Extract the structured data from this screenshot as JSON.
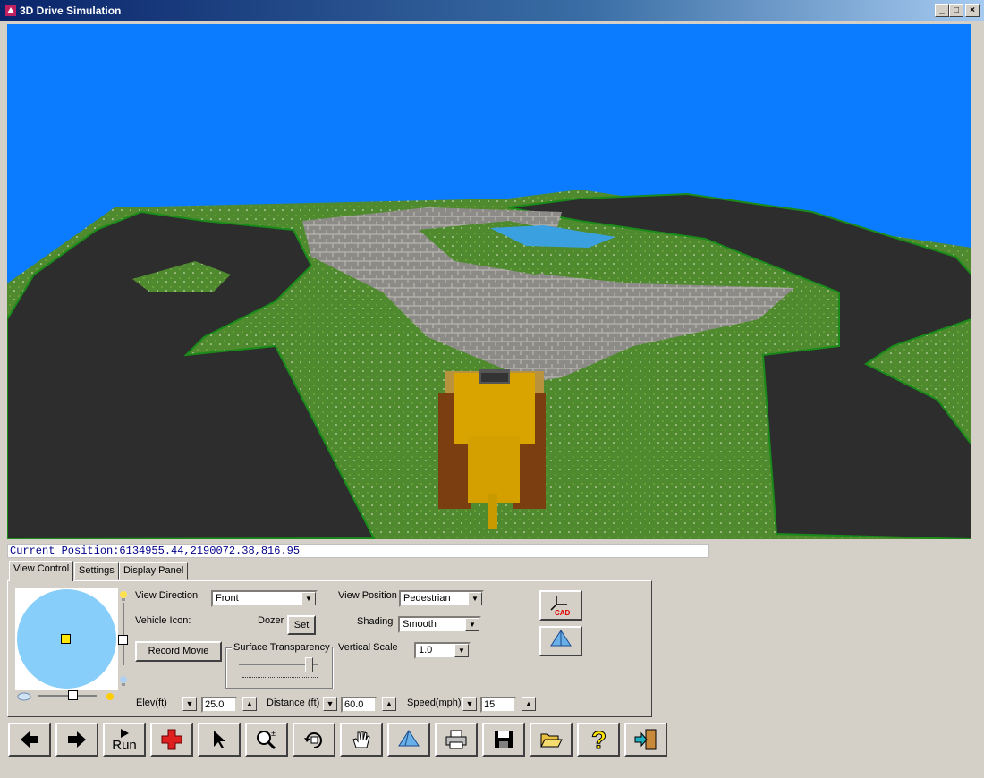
{
  "window": {
    "title": "3D Drive Simulation",
    "minimize": "_",
    "maximize": "□",
    "close": "×"
  },
  "status": {
    "current_position": "Current Position:6134955.44,2190072.38,816.95"
  },
  "tabs": [
    {
      "label": "View Control",
      "active": true
    },
    {
      "label": "Settings",
      "active": false
    },
    {
      "label": "Display Panel",
      "active": false
    }
  ],
  "view_control": {
    "view_direction_label": "View Direction",
    "view_direction_value": "Front",
    "vehicle_icon_label": "Vehicle Icon:",
    "vehicle_icon_value": "Dozer",
    "set_button": "Set",
    "record_movie_button": "Record Movie",
    "surface_transparency_label": "Surface Transparency",
    "view_position_label": "View Position",
    "view_position_value": "Pedestrian",
    "shading_label": "Shading",
    "shading_value": "Smooth",
    "vertical_scale_label": "Vertical Scale",
    "vertical_scale_value": "1.0",
    "elev_label": "Elev(ft)",
    "elev_value": "25.0",
    "distance_label": "Distance (ft)",
    "distance_value": "60.0",
    "speed_label": "Speed(mph)",
    "speed_value": "15",
    "cad_label": "CAD"
  },
  "toolbar": {
    "run_label": "Run",
    "buttons": [
      "back-arrow",
      "forward-arrow",
      "run",
      "add",
      "select-pointer",
      "zoom",
      "rotate",
      "pan",
      "view-3d",
      "print",
      "save",
      "open",
      "help",
      "exit"
    ]
  },
  "colors": {
    "sky": "#0b7bff",
    "grass": "#4f8a2e",
    "asphalt": "#2a2a2a",
    "pavers": "#8a8a8a",
    "water": "#3aa0e0",
    "dozer": "#d4a000",
    "compass_disc": "#87cefa"
  },
  "icons": {
    "app": "app-3d-icon",
    "sun": "sun-icon",
    "bulb": "light-bulb-icon",
    "cloud": "cloud-icon"
  }
}
